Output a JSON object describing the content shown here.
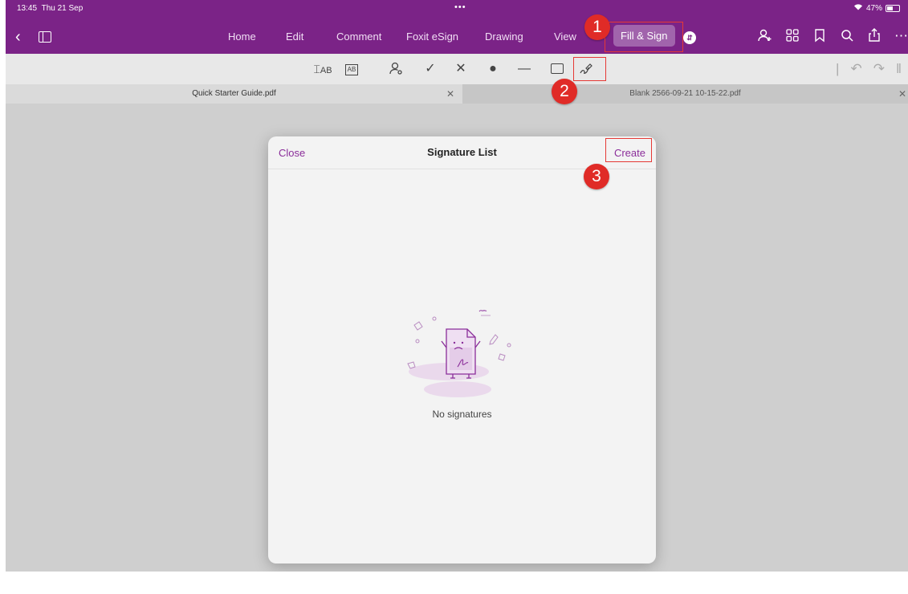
{
  "status": {
    "time": "13:45",
    "date": "Thu 21 Sep",
    "dots": "•••",
    "battery": "47%"
  },
  "nav": {
    "tabs": [
      "Home",
      "Edit",
      "Comment",
      "Foxit eSign",
      "Drawing",
      "View"
    ],
    "active_tab": "Fill & Sign"
  },
  "toolbar": {
    "tools": [
      "text-ab-tool",
      "combed-text-tool",
      "profile-tool",
      "check-tool",
      "cross-tool",
      "dot-tool",
      "line-tool",
      "rectangle-tool",
      "signature-tool"
    ],
    "text_tool_label": "AB",
    "comb_tool_label": "AB"
  },
  "doc_tabs": [
    {
      "name": "Quick Starter Guide.pdf"
    },
    {
      "name": "Blank 2566-09-21 10-15-22.pdf"
    }
  ],
  "modal": {
    "close": "Close",
    "title": "Signature List",
    "create": "Create",
    "empty": "No signatures"
  },
  "annotations": {
    "step1": "1",
    "step2": "2",
    "step3": "3"
  },
  "colors": {
    "brand": "#7b2387",
    "accent": "#8b2e9a",
    "marker": "#e02b27"
  }
}
